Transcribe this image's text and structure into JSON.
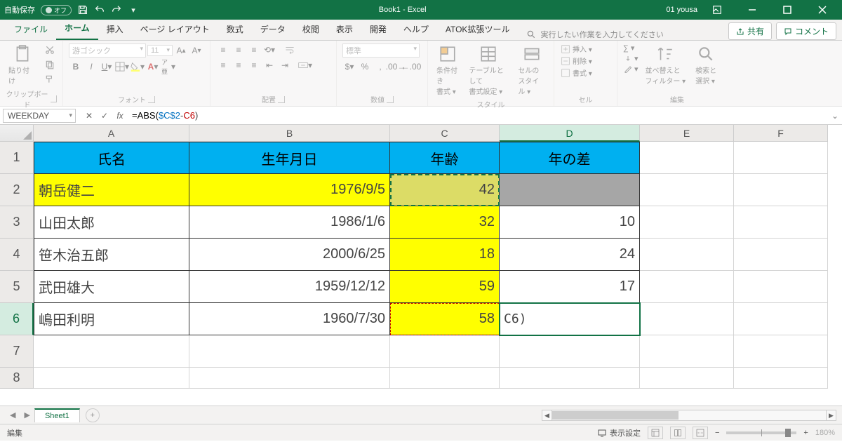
{
  "titlebar": {
    "autosave_label": "自動保存",
    "autosave_state": "オフ",
    "doc_title": "Book1 - Excel",
    "user": "01 yousa"
  },
  "tabs": {
    "file": "ファイル",
    "home": "ホーム",
    "insert": "挿入",
    "layout": "ページ レイアウト",
    "formulas": "数式",
    "data": "データ",
    "review": "校閲",
    "view": "表示",
    "dev": "開発",
    "help": "ヘルプ",
    "atok": "ATOK拡張ツール",
    "tellme_placeholder": "実行したい作業を入力してください",
    "share": "共有",
    "comment": "コメント"
  },
  "ribbon": {
    "clipboard": {
      "paste": "貼り付け",
      "label": "クリップボード"
    },
    "font": {
      "name": "游ゴシック",
      "size": "11",
      "label": "フォント"
    },
    "align": {
      "label": "配置"
    },
    "number": {
      "format": "標準",
      "label": "数値"
    },
    "styles": {
      "cond": "条件付き\n書式 ▾",
      "table": "テーブルとして\n書式設定 ▾",
      "cell": "セルの\nスタイル ▾",
      "label": "スタイル"
    },
    "cells": {
      "insert": "挿入 ▾",
      "delete": "削除 ▾",
      "format": "書式 ▾",
      "label": "セル"
    },
    "editing": {
      "sort": "並べ替えと\nフィルター ▾",
      "find": "検索と\n選択 ▾",
      "label": "編集"
    }
  },
  "namebox": "WEEKDAY",
  "formula": {
    "raw": "=ABS($C$2-C6)",
    "func": "=ABS(",
    "ref1": "$C$2",
    "mid": "-",
    "ref2": "C6",
    "close": ")"
  },
  "columns": [
    "A",
    "B",
    "C",
    "D",
    "E",
    "F"
  ],
  "headers": {
    "A": "氏名",
    "B": "生年月日",
    "C": "年齢",
    "D": "年の差"
  },
  "rows": [
    {
      "n": 1
    },
    {
      "n": 2,
      "A": "朝岳健二",
      "B": "1976/9/5",
      "C": "42",
      "D": ""
    },
    {
      "n": 3,
      "A": "山田太郎",
      "B": "1986/1/6",
      "C": "32",
      "D": "10"
    },
    {
      "n": 4,
      "A": "笹木治五郎",
      "B": "2000/6/25",
      "C": "18",
      "D": "24"
    },
    {
      "n": 5,
      "A": "武田雄大",
      "B": "1959/12/12",
      "C": "59",
      "D": "17"
    },
    {
      "n": 6,
      "A": "嶋田利明",
      "B": "1960/7/30",
      "C": "58",
      "D_edit": "C6)"
    },
    {
      "n": 7
    },
    {
      "n": 8
    }
  ],
  "sheet_tab": "Sheet1",
  "status": {
    "mode": "編集",
    "display_settings": "表示設定",
    "zoom": "180%"
  }
}
